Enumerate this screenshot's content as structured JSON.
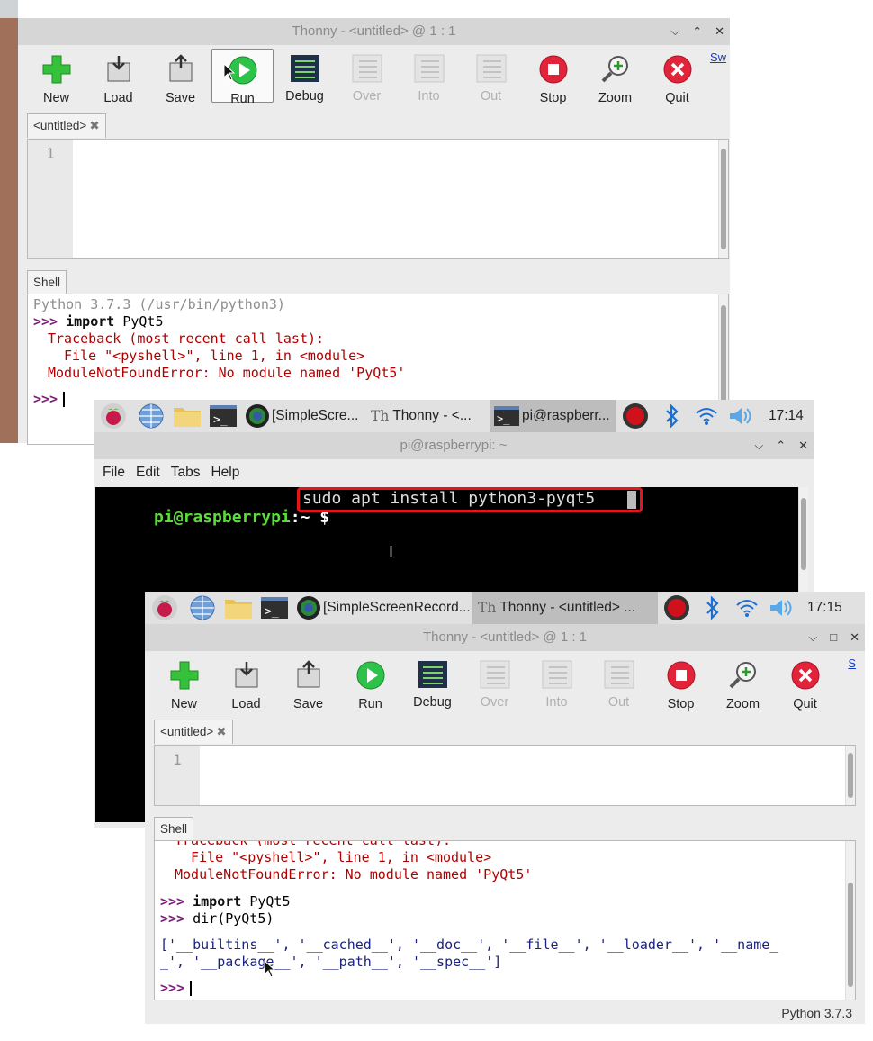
{
  "win1": {
    "title": "Thonny  -  <untitled>  @  1 : 1",
    "toolbar": [
      {
        "label": "New",
        "icon": "new-icon",
        "disabled": false
      },
      {
        "label": "Load",
        "icon": "load-icon",
        "disabled": false
      },
      {
        "label": "Save",
        "icon": "save-icon",
        "disabled": false
      },
      {
        "label": "Run",
        "icon": "run-icon",
        "disabled": false
      },
      {
        "label": "Debug",
        "icon": "debug-icon",
        "disabled": false
      },
      {
        "label": "Over",
        "icon": "step-over-icon",
        "disabled": true
      },
      {
        "label": "Into",
        "icon": "step-into-icon",
        "disabled": true
      },
      {
        "label": "Out",
        "icon": "step-out-icon",
        "disabled": true
      },
      {
        "label": "Stop",
        "icon": "stop-icon",
        "disabled": false
      },
      {
        "label": "Zoom",
        "icon": "zoom-icon",
        "disabled": false
      },
      {
        "label": "Quit",
        "icon": "quit-icon",
        "disabled": false
      }
    ],
    "side_link": "Sw",
    "editor_tab": "<untitled>",
    "line_number": "1",
    "shell_tab": "Shell",
    "shell": {
      "version_line": "Python 3.7.3 (/usr/bin/python3)",
      "prompt": ">>>",
      "import_kw": "import",
      "import_mod": "PyQt5",
      "tb1": "Traceback (most recent call last):",
      "tb2": "File \"<pyshell>\", line 1, in <module>",
      "tb3": "ModuleNotFoundError: No module named 'PyQt5'"
    }
  },
  "taskbar1": {
    "items": [
      "[SimpleScre...",
      "Thonny  -  <...",
      "pi@raspberr..."
    ],
    "time": "17:14"
  },
  "terminal": {
    "title": "pi@raspberrypi: ~",
    "menu": [
      "File",
      "Edit",
      "Tabs",
      "Help"
    ],
    "user_host": "pi@raspberrypi",
    "path": ":~ $ ",
    "command": "sudo apt install python3-pyqt5"
  },
  "taskbar2": {
    "items": [
      "[SimpleScreenRecord...",
      "Thonny  -  <untitled>  ..."
    ],
    "time": "17:15"
  },
  "win2": {
    "title": "Thonny  -  <untitled>  @  1 : 1",
    "side_link": "S",
    "editor_tab": "<untitled>",
    "line_number": "1",
    "shell_tab": "Shell",
    "shell": {
      "cut_line": "Traceback (most recent call last):",
      "tb2": "File \"<pyshell>\", line 1, in <module>",
      "tb3": "ModuleNotFoundError: No module named 'PyQt5'",
      "prompt": ">>>",
      "import_kw": "import",
      "import_mod": "PyQt5",
      "dir_call": "dir(PyQt5)",
      "out1": "['__builtins__', '__cached__', '__doc__', '__file__', '__loader__', '__name_",
      "out2": "_', '__package__', '__path__', '__spec__']"
    },
    "status": "Python 3.7.3"
  }
}
